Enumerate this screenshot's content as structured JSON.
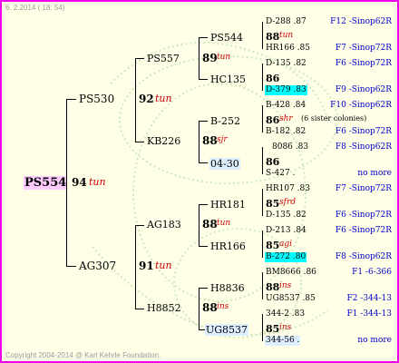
{
  "header": {
    "date": "6. 2.2014 ( 18: 54)",
    "copyright": "Copyright 2004-2014 @ Karl Kehrle Foundation."
  },
  "root": {
    "name": "PS554",
    "num": "94",
    "tag": "tun"
  },
  "gen1": [
    {
      "name": "PS530",
      "num": "92",
      "tag": "tun"
    },
    {
      "name": "AG307",
      "num": "91",
      "tag": "tun"
    }
  ],
  "gen2": [
    {
      "name": "PS557",
      "num": "89",
      "tag": "tun"
    },
    {
      "name": "KB226",
      "num": "88",
      "tag": "sjr"
    },
    {
      "name": "AG183",
      "num": "88",
      "tag": "tun"
    },
    {
      "name": "H8852",
      "num": "88",
      "tag": "ins"
    }
  ],
  "gen3": [
    {
      "name": "PS544"
    },
    {
      "name": "HC135"
    },
    {
      "name": "B-252"
    },
    {
      "name": "04-30"
    },
    {
      "name": "HR181"
    },
    {
      "name": "HR166"
    },
    {
      "name": "H8836"
    },
    {
      "name": "UG8537"
    }
  ],
  "gen4": [
    {
      "top": "D-288 .87",
      "num": "88",
      "tag": "tun",
      "tag2": "",
      "bottom": "HR166 .85",
      "top_right": "F12 -Sinop62R",
      "bottom_right": "F7 -Sinop72R"
    },
    {
      "top": "D-135 .82",
      "num": "86",
      "tag": "",
      "tag2": "",
      "bottom": "D-379 .83",
      "top_right": "F6 -Sinop72R",
      "bottom_right": "F9 -Sinop62R"
    },
    {
      "top": "B-428 .84",
      "num": "86",
      "tag": "shr",
      "tag2": "(6 sister colonies)",
      "bottom": "B-182 .82",
      "top_right": "F10 -Sinop62R",
      "bottom_right": "F6 -Sinop72R"
    },
    {
      "top": "8086 .83",
      "num": "86",
      "tag": "",
      "tag2": "",
      "bottom": "S-427 .",
      "top_right": "F8 -Sinop62R",
      "bottom_right": "no more"
    },
    {
      "top": "HR107 .83",
      "num": "85",
      "tag": "sfrd",
      "tag2": "",
      "bottom": "D-135 .82",
      "top_right": "F7 -Sinop72R",
      "bottom_right": "F6 -Sinop72R"
    },
    {
      "top": "D-213 .84",
      "num": "85",
      "tag": "agi",
      "tag2": "",
      "bottom": "B-272 .80",
      "top_right": "F6 -Sinop72R",
      "bottom_right": "F8 -Sinop62R"
    },
    {
      "top": "BM8666 .86",
      "num": "88",
      "tag": "ins",
      "tag2": "",
      "bottom": "UG8537 .85",
      "top_right": "F1 -6-366",
      "bottom_right": "F2 -344-13"
    },
    {
      "top": "344-2 .83",
      "num": "85",
      "tag": "ins",
      "tag2": "",
      "bottom": "344-56 .",
      "top_right": "F1 -344-13",
      "bottom_right": "no more"
    }
  ],
  "colors": {
    "border": "#ee00ee",
    "background": "#ffffe8",
    "highlight_root": "#ffccff",
    "highlight_cyan": "#00ffff",
    "highlight_lav": "#ddeeff",
    "label": "#0000cc",
    "tag": "#cc0000"
  }
}
